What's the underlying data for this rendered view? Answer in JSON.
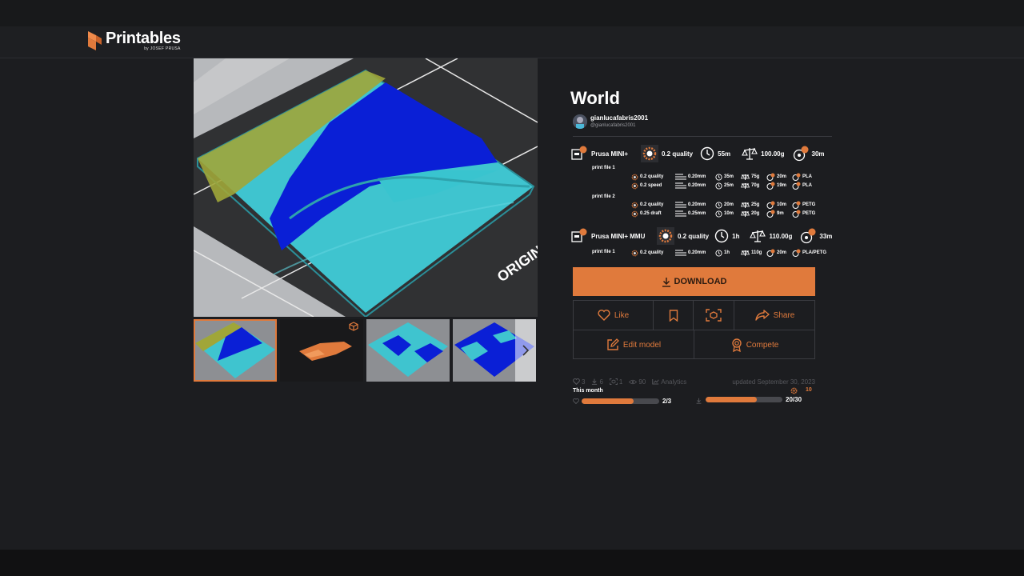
{
  "header": {
    "logo_name": "Printables",
    "logo_sub": "by JOSEF PRUSA"
  },
  "model": {
    "title": "World",
    "author_name": "gianlucafabris2001",
    "author_handle": "@gianlucafabris2001"
  },
  "gallery": {
    "thumbnail_count": 4,
    "main_image_overlay_text": "ORIGIN"
  },
  "printers": [
    {
      "name": "Prusa MINI+",
      "quality": "0.2 quality",
      "time": "55m",
      "weight": "100.00g",
      "filament_time": "30m",
      "files": [
        {
          "label": "print file 1",
          "lines": [
            {
              "quality": "0.2 quality",
              "layer": "0.20mm",
              "time": "35m",
              "weight": "75g",
              "ftime": "20m",
              "material": "PLA"
            },
            {
              "quality": "0.2 speed",
              "layer": "0.20mm",
              "time": "25m",
              "weight": "70g",
              "ftime": "19m",
              "material": "PLA"
            }
          ]
        },
        {
          "label": "print file 2",
          "lines": [
            {
              "quality": "0.2 quality",
              "layer": "0.20mm",
              "time": "20m",
              "weight": "25g",
              "ftime": "10m",
              "material": "PETG"
            },
            {
              "quality": "0.25 draft",
              "layer": "0.25mm",
              "time": "10m",
              "weight": "20g",
              "ftime": "9m",
              "material": "PETG"
            }
          ]
        }
      ]
    },
    {
      "name": "Prusa MINI+ MMU",
      "quality": "0.2 quality",
      "time": "1h",
      "weight": "110.00g",
      "filament_time": "33m",
      "files": [
        {
          "label": "print file 1",
          "lines": [
            {
              "quality": "0.2 quality",
              "layer": "0.20mm",
              "time": "1h",
              "weight": "110g",
              "ftime": "20m",
              "material": "PLA/PETG"
            }
          ]
        }
      ]
    }
  ],
  "actions": {
    "download": "DOWNLOAD",
    "like": "Like",
    "share": "Share",
    "edit": "Edit model",
    "compete": "Compete"
  },
  "stats": {
    "likes": "3",
    "downloads": "6",
    "makes": "1",
    "views": "90",
    "analytics": "Analytics",
    "updated": "updated September 30, 2023",
    "this_month": "This month",
    "likes_progress_label": "2/3",
    "likes_progress": 0.6667,
    "downloads_progress_label": "20/30",
    "downloads_progress": 0.6667,
    "prize": "10"
  },
  "colors": {
    "accent": "#e07a3c",
    "background": "#1c1d20"
  }
}
